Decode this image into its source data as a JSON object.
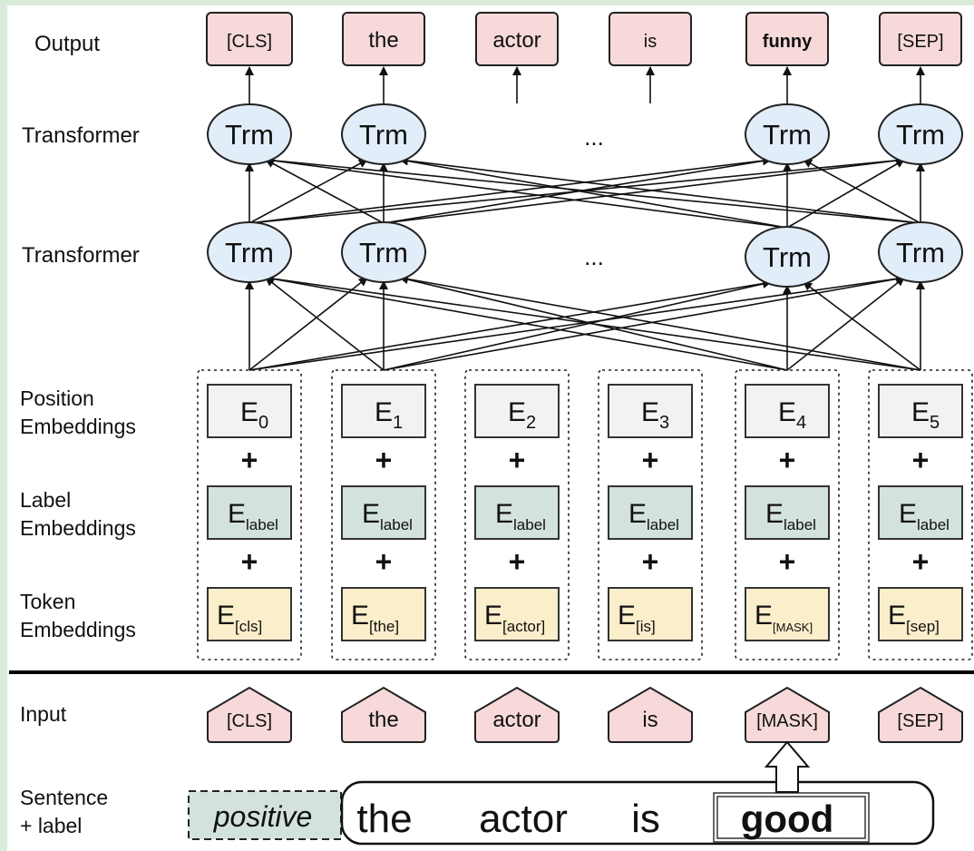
{
  "row_labels": {
    "output": "Output",
    "transformer_top": "Transformer",
    "transformer_mid": "Transformer",
    "position": [
      "Position",
      "Embeddings"
    ],
    "label": [
      "Label",
      "Embeddings"
    ],
    "token": [
      "Token",
      "Embeddings"
    ],
    "input": "Input",
    "sentence": [
      "Sentence",
      "+ label"
    ]
  },
  "outputs": [
    "[CLS]",
    "the",
    "actor",
    "is",
    "funny",
    "[SEP]"
  ],
  "trm_label": "Trm",
  "ellipsis": "...",
  "position_embeddings": [
    {
      "base": "E",
      "sub": "0"
    },
    {
      "base": "E",
      "sub": "1"
    },
    {
      "base": "E",
      "sub": "2"
    },
    {
      "base": "E",
      "sub": "3"
    },
    {
      "base": "E",
      "sub": "4"
    },
    {
      "base": "E",
      "sub": "5"
    }
  ],
  "label_embeddings": [
    {
      "base": "E",
      "sub": "label"
    },
    {
      "base": "E",
      "sub": "label"
    },
    {
      "base": "E",
      "sub": "label"
    },
    {
      "base": "E",
      "sub": "label"
    },
    {
      "base": "E",
      "sub": "label"
    },
    {
      "base": "E",
      "sub": "label"
    }
  ],
  "token_embeddings": [
    {
      "base": "E",
      "sub": "[cls]"
    },
    {
      "base": "E",
      "sub": "[the]"
    },
    {
      "base": "E",
      "sub": "[actor]"
    },
    {
      "base": "E",
      "sub": "[is]"
    },
    {
      "base": "E",
      "sub": "[MASK]"
    },
    {
      "base": "E",
      "sub": "[sep]"
    }
  ],
  "plus": "+",
  "inputs": [
    "[CLS]",
    "the",
    "actor",
    "is",
    "[MASK]",
    "[SEP]"
  ],
  "sentence": {
    "label": "positive",
    "words": [
      "the",
      "actor",
      "is"
    ],
    "masked_word": "good"
  },
  "colors": {
    "token_pink": "#f7d9d9",
    "trm_blue": "#e1edf9",
    "position_gray": "#f2f2f2",
    "label_green": "#d3e3db",
    "token_yellow": "#fbeecb",
    "frame_green": "#d9ecd9"
  }
}
